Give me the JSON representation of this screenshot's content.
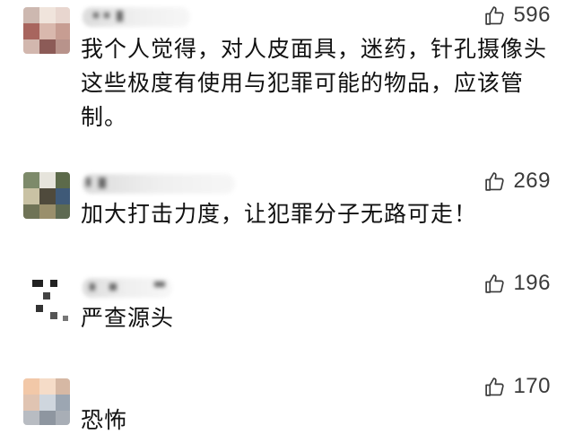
{
  "colors": {
    "background": "#ffffff",
    "text": "#111111",
    "like": "#3a3a3a"
  },
  "comments": [
    {
      "text": "我个人觉得，对人皮面具，迷药，针孔摄像头这些极度有使用与犯罪可能的物品，应该管制。",
      "likes": "596",
      "icon": "thumbs-up-icon"
    },
    {
      "text": "加大打击力度，让犯罪分子无路可走！",
      "likes": "269",
      "icon": "thumbs-up-icon"
    },
    {
      "text": "严查源头",
      "likes": "196",
      "icon": "thumbs-up-icon"
    },
    {
      "text": "恐怖",
      "likes": "170",
      "icon": "thumbs-up-icon"
    }
  ]
}
